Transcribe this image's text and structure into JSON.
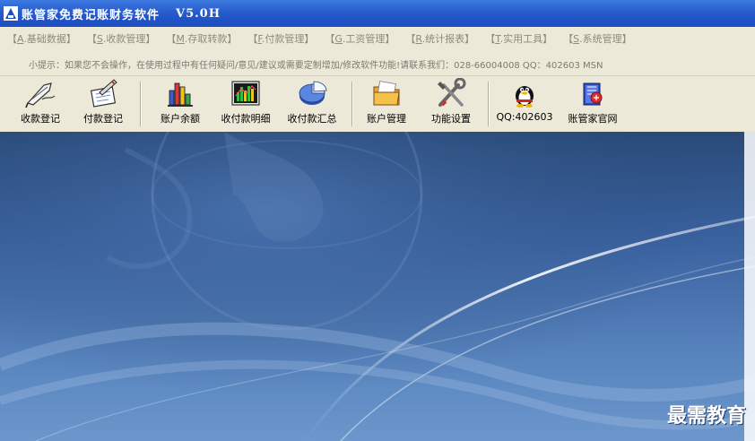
{
  "window": {
    "title": "账管家免费记账财务软件",
    "version": "V5.0H"
  },
  "menu": [
    {
      "prefix": "【",
      "key": "A",
      "label": ".基础数据】"
    },
    {
      "prefix": "【",
      "key": "S",
      "label": ".收款管理】"
    },
    {
      "prefix": "【",
      "key": "M",
      "label": ".存取转款】"
    },
    {
      "prefix": "【",
      "key": "F",
      "label": ".付款管理】"
    },
    {
      "prefix": "【",
      "key": "G",
      "label": ".工资管理】"
    },
    {
      "prefix": "【",
      "key": "R",
      "label": ".统计报表】"
    },
    {
      "prefix": "【",
      "key": "T",
      "label": ".实用工具】"
    },
    {
      "prefix": "【",
      "key": "S",
      "label": ".系统管理】"
    }
  ],
  "tip": {
    "text": "小提示：如果您不会操作，在使用过程中有任何疑问/意见/建议或需要定制增加/修改软件功能!请联系我们：028-66004008 QQ：402603 MSN"
  },
  "toolbar": {
    "items": [
      {
        "label": "收款登记",
        "icon": "quill-pen-icon"
      },
      {
        "label": "付款登记",
        "icon": "notepad-pen-icon"
      },
      {
        "label": "账户余额",
        "icon": "bar-chart-icon"
      },
      {
        "label": "收付款明细",
        "icon": "chart-detail-icon"
      },
      {
        "label": "收付款汇总",
        "icon": "pie-chart-icon"
      },
      {
        "label": "账户管理",
        "icon": "folder-icon"
      },
      {
        "label": "功能设置",
        "icon": "tools-icon"
      },
      {
        "label": "QQ:402603",
        "icon": "qq-penguin-icon"
      },
      {
        "label": "账管家官网",
        "icon": "website-icon"
      }
    ]
  },
  "workspace": {
    "watermark": "最需教育"
  },
  "colors": {
    "title_bar": "#2a5fd0",
    "menu_bar": "#ece9d8",
    "workspace": "#3a62a0"
  }
}
